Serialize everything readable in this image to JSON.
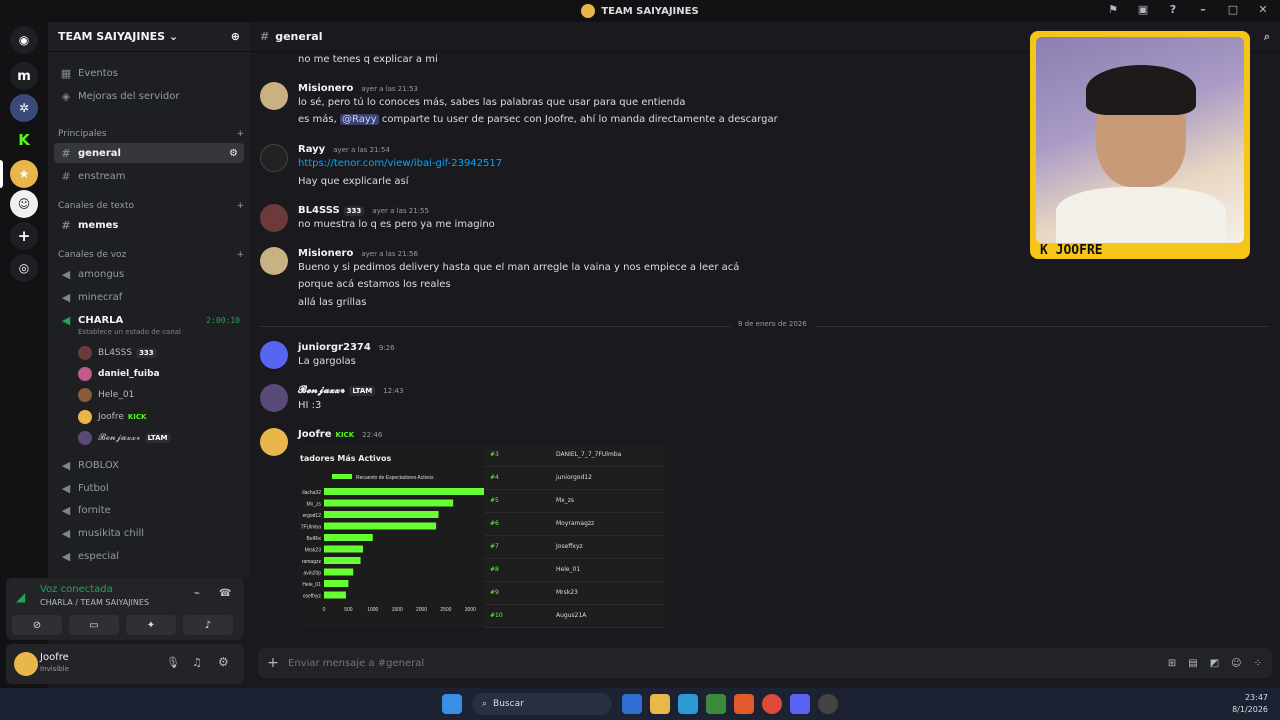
{
  "window": {
    "title": "TEAM SAIYAJINES"
  },
  "server": {
    "name": "TEAM SAIYAJINES ⌄"
  },
  "top_items": {
    "events": "Eventos",
    "boosts": "Mejoras del servidor"
  },
  "categories": {
    "principales": "Principales",
    "texto": "Canales de texto",
    "voz": "Canales de voz"
  },
  "channels": {
    "general": "general",
    "enstream": "enstream",
    "memes": "memes",
    "amongus": "amongus",
    "minecraf": "minecraf",
    "charla": "CHARLA",
    "charla_timer": "2:00:10",
    "charla_status": "Establece un estado de canal",
    "roblox": "ROBLOX",
    "futbol": "Futbol",
    "fornite": "fornite",
    "musikita": "musikita chill",
    "especial": "especial"
  },
  "voice_users": [
    {
      "name": "BL4SSS",
      "tag": "333"
    },
    {
      "name": "daniel_fuiba"
    },
    {
      "name": "Hele_01"
    },
    {
      "name": "Joofre",
      "tag": "KICK"
    },
    {
      "name": "𝓑𝓮𝓷𝓳𝓪𝔁𝔁꘎",
      "tag": "LTAM"
    }
  ],
  "voice_panel": {
    "status": "Voz conectada",
    "location": "CHARLA / TEAM SAIYAJINES"
  },
  "user_panel": {
    "name": "Joofre",
    "status": "Invisible"
  },
  "chat": {
    "channel": "general",
    "date_divider": "8 de enero de 2026",
    "placeholder": "Enviar mensaje a #general"
  },
  "messages": [
    {
      "line": "no me tenes q explicar a mi"
    },
    {
      "author": "Misionero",
      "time": "ayer a las 21:53",
      "lines": [
        "lo sé, pero tú lo conoces más, sabes las palabras que usar para que entienda"
      ],
      "mention_pre": "es más, ",
      "mention": "@Rayy",
      "mention_post": " comparte tu user de parsec con Joofre, ahí lo manda directamente a descargar"
    },
    {
      "author": "Rayy",
      "time": "ayer a las 21:54",
      "link": "https://tenor.com/view/ibai-gif-23942517",
      "lines": [
        "Hay que explicarle así"
      ]
    },
    {
      "author": "BL4SSS",
      "tag": "333",
      "time": "ayer a las 21:55",
      "lines": [
        "no muestra lo q es pero ya me imagino"
      ]
    },
    {
      "author": "Misionero",
      "time": "ayer a las 21:56",
      "lines": [
        "Bueno y si pedimos delivery hasta que el man arregle la vaina y nos empiece a leer acá",
        "porque acá estamos los reales",
        "allá las grillas"
      ]
    },
    {
      "author": "juniorgr2374",
      "time": "9:26",
      "lines": [
        "La gargolas"
      ]
    },
    {
      "author": "𝓑𝓮𝓷𝓳𝓪𝔁𝔁꘎",
      "tag": "LTAM",
      "time": "12:43",
      "lines": [
        "HI :3"
      ]
    },
    {
      "author": "Joofre",
      "tag": "KICK",
      "time": "22:46"
    }
  ],
  "embed": {
    "title": "tadores Más Activos",
    "legend": "Recuento de Espectadores Activos",
    "ranks": [
      "#3",
      "#4",
      "#5",
      "#6",
      "#7",
      "#8",
      "#9",
      "#10"
    ],
    "rank_names": [
      "DANIEL_7_7_7FUlmba",
      "juniorgod12",
      "Mx_zs",
      "Moyramagzz",
      "Joseffxyz",
      "Hele_01",
      "Mrsk23",
      "Augus21A"
    ]
  },
  "chart_data": {
    "type": "bar",
    "orientation": "horizontal",
    "title": "tadores Más Activos",
    "legend": [
      "Recuento de Espectadores Activos"
    ],
    "categories": [
      "ilacha32",
      "Mx_zs",
      "ergod12",
      "7FUlmba",
      "BelRix",
      "Mrsk23",
      "ramagzz",
      "avin20p",
      "Hele_01",
      "oseffxyz"
    ],
    "values": [
      3300,
      2650,
      2350,
      2300,
      1000,
      800,
      750,
      600,
      500,
      450
    ],
    "x_ticks": [
      "0",
      "500",
      "1000",
      "1500",
      "2000",
      "2500",
      "3000"
    ],
    "xlim": [
      0,
      3200
    ],
    "bar_color": "#66ff33"
  },
  "taskbar": {
    "search": "Buscar",
    "time": "23:47",
    "date": "8/1/2026"
  },
  "webcam": {
    "label": "K JOOFRE"
  }
}
